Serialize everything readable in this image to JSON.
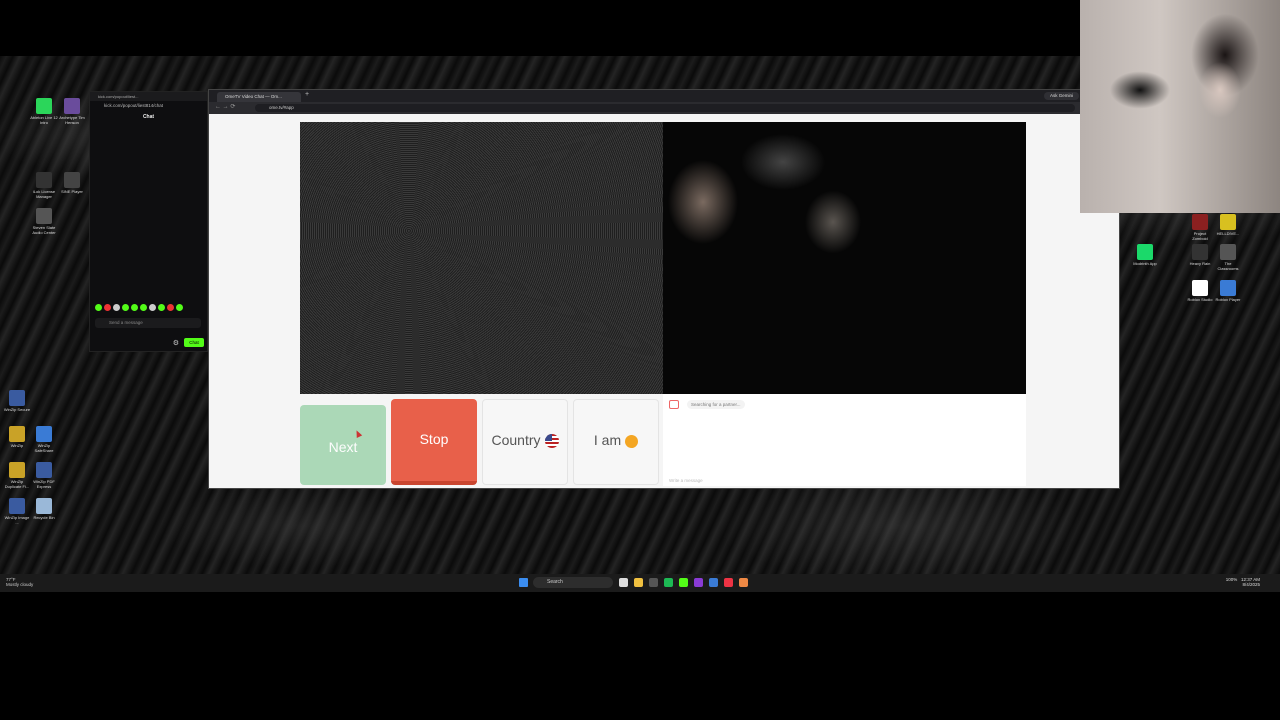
{
  "desktop": {
    "icons_left": [
      {
        "label": "Ableton Live 12 Intro",
        "color": "#2bd65a"
      },
      {
        "label": "Archetype Tim Henson",
        "color": "#6a4c9c"
      },
      {
        "label": "iLok License Manager",
        "color": "#333333"
      },
      {
        "label": "SINE Player",
        "color": "#444444"
      },
      {
        "label": "Steven Slate Audio Center",
        "color": "#555555"
      },
      {
        "label": "WinZip Secure",
        "color": "#3a5ba0"
      },
      {
        "label": "WinZip",
        "color": "#c9a227"
      },
      {
        "label": "WinZip SafeShare",
        "color": "#3a7bd5"
      },
      {
        "label": "WinZip Duplicate Fi...",
        "color": "#c9a227"
      },
      {
        "label": "WinZip PDF Express",
        "color": "#3a5ba0"
      },
      {
        "label": "WinZip Image ...",
        "color": "#3a5ba0"
      },
      {
        "label": "Recycle Bin",
        "color": "#9ab8d8"
      }
    ],
    "icons_right": [
      {
        "label": "Project Zomboid",
        "color": "#8b2020"
      },
      {
        "label": "HELLDIVE...",
        "color": "#d8c020"
      },
      {
        "label": "Modrinth App",
        "color": "#1bd96a"
      },
      {
        "label": "Heavy Rain",
        "color": "#333333"
      },
      {
        "label": "The Classrooms",
        "color": "#555555"
      },
      {
        "label": "Roblox Studio",
        "color": "#ffffff"
      },
      {
        "label": "Roblox Player",
        "color": "#3a7bd5"
      }
    ]
  },
  "kick": {
    "tab_title": "kick.com/popout/liest...",
    "url": "kick.com/popout/liest814/chat",
    "header": "Chat",
    "message_placeholder": "Send a message",
    "chat_button": "Chat"
  },
  "browser": {
    "tab_title": "OmeTV Video Chat — Om...",
    "gemini": "Ask Gemini",
    "url": "ome.tv/#app"
  },
  "ometv": {
    "next": "Next",
    "stop": "Stop",
    "country": "Country",
    "iam": "I am",
    "status": "Searching for a partner...",
    "write_placeholder": "Write a message"
  },
  "taskbar": {
    "weather_temp": "77°F",
    "weather_desc": "Mostly cloudy",
    "search": "Search",
    "battery": "100%",
    "time": "12:37 AM",
    "date": "8/4/2025"
  },
  "colors": {
    "next": "#9fd4ad",
    "stop": "#e8604a",
    "kick_green": "#53fc18"
  }
}
